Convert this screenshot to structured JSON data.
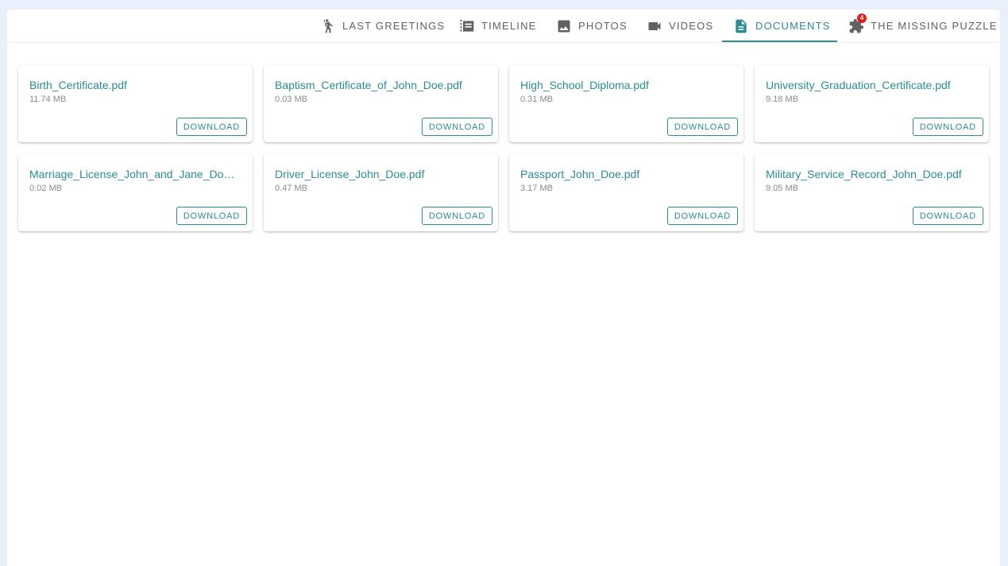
{
  "tabs": [
    {
      "label": "LAST GREETINGS",
      "icon": "person-waving-icon"
    },
    {
      "label": "TIMELINE",
      "icon": "timeline-icon"
    },
    {
      "label": "PHOTOS",
      "icon": "image-icon"
    },
    {
      "label": "VIDEOS",
      "icon": "videocam-icon"
    },
    {
      "label": "DOCUMENTS",
      "icon": "document-icon",
      "active": true
    },
    {
      "label": "THE MISSING PUZZLE",
      "icon": "puzzle-icon",
      "badge": "4"
    }
  ],
  "colors": {
    "accent": "#2b8c96",
    "badge": "#e31b1b",
    "page_background": "#e8f0fb",
    "inactive_tab": "#616161"
  },
  "documents": [
    {
      "name": "Birth_Certificate.pdf",
      "size": "11.74 MB",
      "action": "DOWNLOAD"
    },
    {
      "name": "Baptism_Certificate_of_John_Doe.pdf",
      "size": "0.03 MB",
      "action": "DOWNLOAD"
    },
    {
      "name": "High_School_Diploma.pdf",
      "size": "0.31 MB",
      "action": "DOWNLOAD"
    },
    {
      "name": "University_Graduation_Certificate.pdf",
      "size": "9.18 MB",
      "action": "DOWNLOAD"
    },
    {
      "name": "Marriage_License_John_and_Jane_Doe.pdf",
      "size": "0.02 MB",
      "action": "DOWNLOAD"
    },
    {
      "name": "Driver_License_John_Doe.pdf",
      "size": "0.47 MB",
      "action": "DOWNLOAD"
    },
    {
      "name": "Passport_John_Doe.pdf",
      "size": "3.17 MB",
      "action": "DOWNLOAD"
    },
    {
      "name": "Military_Service_Record_John_Doe.pdf",
      "size": "9.05 MB",
      "action": "DOWNLOAD"
    }
  ]
}
